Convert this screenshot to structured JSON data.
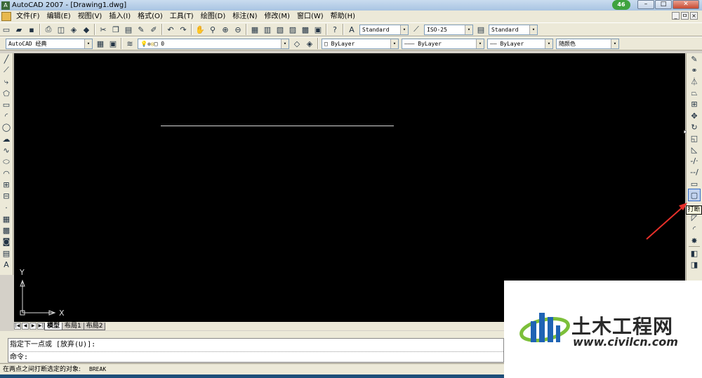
{
  "window": {
    "title": "AutoCAD 2007 - [Drawing1.dwg]",
    "badge": "46",
    "min": "–",
    "max": "□",
    "close": "✕"
  },
  "menu": [
    "文件(F)",
    "编辑(E)",
    "视图(V)",
    "插入(I)",
    "格式(O)",
    "工具(T)",
    "绘图(D)",
    "标注(N)",
    "修改(M)",
    "窗口(W)",
    "帮助(H)"
  ],
  "mdi_controls": [
    "_",
    "ㅁ",
    "×"
  ],
  "toolbar2": {
    "text_style": "Standard",
    "dim_style": "ISO-25",
    "table_style": "Standard"
  },
  "toolbar3": {
    "workspace": "AutoCAD 经典",
    "layer": "0",
    "color": "ByLayer",
    "linetype": "ByLayer",
    "lineweight": "ByLayer",
    "plotstyle": "随颜色"
  },
  "canvas": {
    "ucs_y": "Y",
    "ucs_x": "X"
  },
  "tabs": {
    "model": "模型",
    "layout1": "布局1",
    "layout2": "布局2"
  },
  "command": {
    "history": "指定下一点或 [放弃(U)]:",
    "prompt": "命令:"
  },
  "status": {
    "text": "在两点之间打断选定的对象:",
    "command": "BREAK"
  },
  "tooltip": "打断",
  "watermark": {
    "cn": "土木工程网",
    "url": "www.civilcn.com"
  },
  "colors": {
    "canvas": "#000000",
    "line": "#d8d8d8",
    "arrow": "#e8302a"
  }
}
